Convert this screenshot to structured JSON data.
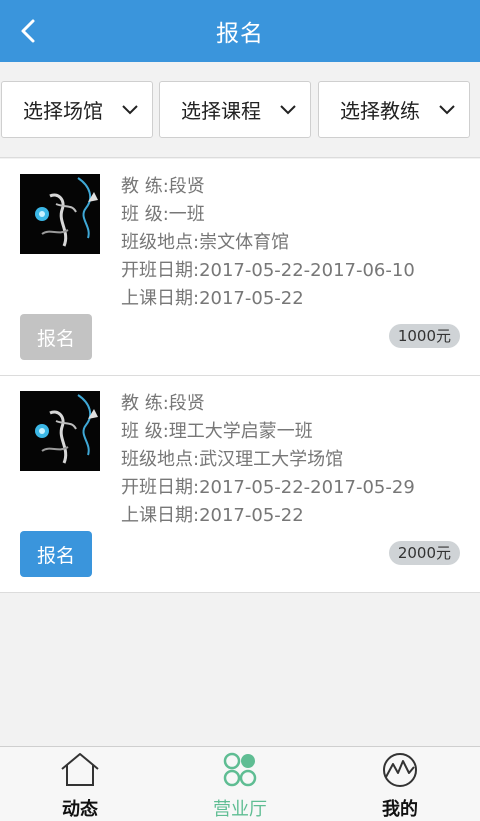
{
  "header": {
    "title": "报名"
  },
  "filters": [
    {
      "label": "选择场馆"
    },
    {
      "label": "选择课程"
    },
    {
      "label": "选择教练"
    }
  ],
  "classes": [
    {
      "coach": "教  练:段贤",
      "class_name": "班  级:一班",
      "location": "班级地点:崇文体育馆",
      "open_dates": "开班日期:2017-05-22-2017-06-10",
      "lesson_date": "上课日期:2017-05-22",
      "button_label": "报名",
      "button_state": "disabled",
      "price": "1000元"
    },
    {
      "coach": "教  练:段贤",
      "class_name": "班  级:理工大学启蒙一班",
      "location": "班级地点:武汉理工大学场馆",
      "open_dates": "开班日期:2017-05-22-2017-05-29",
      "lesson_date": "上课日期:2017-05-22",
      "button_label": "报名",
      "button_state": "active",
      "price": "2000元"
    }
  ],
  "tabbar": {
    "items": [
      {
        "label": "动态",
        "icon": "home-icon",
        "selected": false
      },
      {
        "label": "营业厅",
        "icon": "circles-icon",
        "selected": true
      },
      {
        "label": "我的",
        "icon": "profile-icon",
        "selected": false
      }
    ]
  },
  "colors": {
    "header": "#3a95dc",
    "accent_green": "#5fbd93",
    "disabled_button": "#c3c3c3",
    "active_button": "#3a95dc"
  }
}
